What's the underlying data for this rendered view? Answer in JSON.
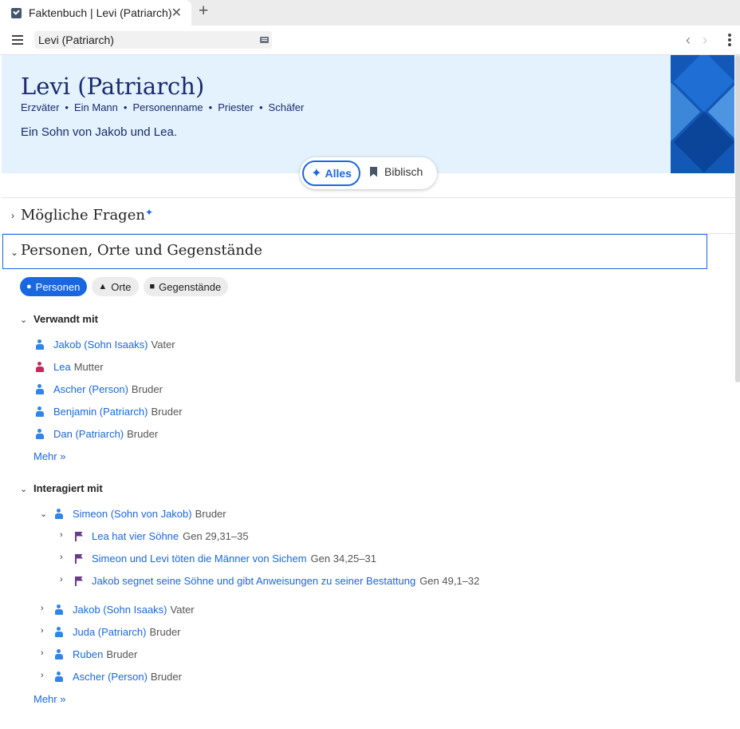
{
  "browser": {
    "tab_title": "Faktenbuch | Levi (Patriarch)",
    "tab_close": "✕",
    "new_tab": "+",
    "address": "Levi (Patriarch)",
    "back": "‹",
    "forward": "›"
  },
  "hero": {
    "title": "Levi (Patriarch)",
    "categories": [
      "Erzväter",
      "Ein Mann",
      "Personenname",
      "Priester",
      "Schäfer"
    ],
    "bullet": "•",
    "description": "Ein Sohn von Jakob und Lea."
  },
  "filter": {
    "alles_label": "Alles",
    "biblisch_label": "Biblisch"
  },
  "sections": {
    "fragen_title": "Mögliche Fragen",
    "personen_title": "Personen, Orte und Gegenstände"
  },
  "chips": {
    "personen": "Personen",
    "orte": "Orte",
    "gegenstaende": "Gegenstände"
  },
  "verwandt": {
    "title": "Verwandt mit",
    "items": [
      {
        "name": "Jakob (Sohn Isaaks)",
        "relation": "Vater",
        "gender": "male"
      },
      {
        "name": "Lea",
        "relation": "Mutter",
        "gender": "female"
      },
      {
        "name": "Ascher (Person)",
        "relation": "Bruder",
        "gender": "male"
      },
      {
        "name": "Benjamin (Patriarch)",
        "relation": "Bruder",
        "gender": "male"
      },
      {
        "name": "Dan (Patriarch)",
        "relation": "Bruder",
        "gender": "male"
      }
    ],
    "more": "Mehr »"
  },
  "interagiert": {
    "title": "Interagiert mit",
    "expanded": {
      "name": "Simeon (Sohn von Jakob)",
      "relation": "Bruder"
    },
    "events": [
      {
        "title": "Lea hat vier Söhne",
        "ref": "Gen 29,31–35"
      },
      {
        "title": "Simeon und Levi töten die Männer von Sichem",
        "ref": "Gen 34,25–31"
      },
      {
        "title": "Jakob segnet seine Söhne und gibt Anweisungen zu seiner Bestattung",
        "ref": "Gen 49,1–32"
      }
    ],
    "items": [
      {
        "name": "Jakob (Sohn Isaaks)",
        "relation": "Vater"
      },
      {
        "name": "Juda (Patriarch)",
        "relation": "Bruder"
      },
      {
        "name": "Ruben",
        "relation": "Bruder"
      },
      {
        "name": "Ascher (Person)",
        "relation": "Bruder"
      }
    ],
    "more": "Mehr »"
  },
  "colors": {
    "accent": "#1a68e0",
    "hero_bg": "#e3f2fd",
    "hero_text": "#1a2a6c",
    "female_icon": "#c9275b",
    "event_flag": "#6a3a8c"
  }
}
